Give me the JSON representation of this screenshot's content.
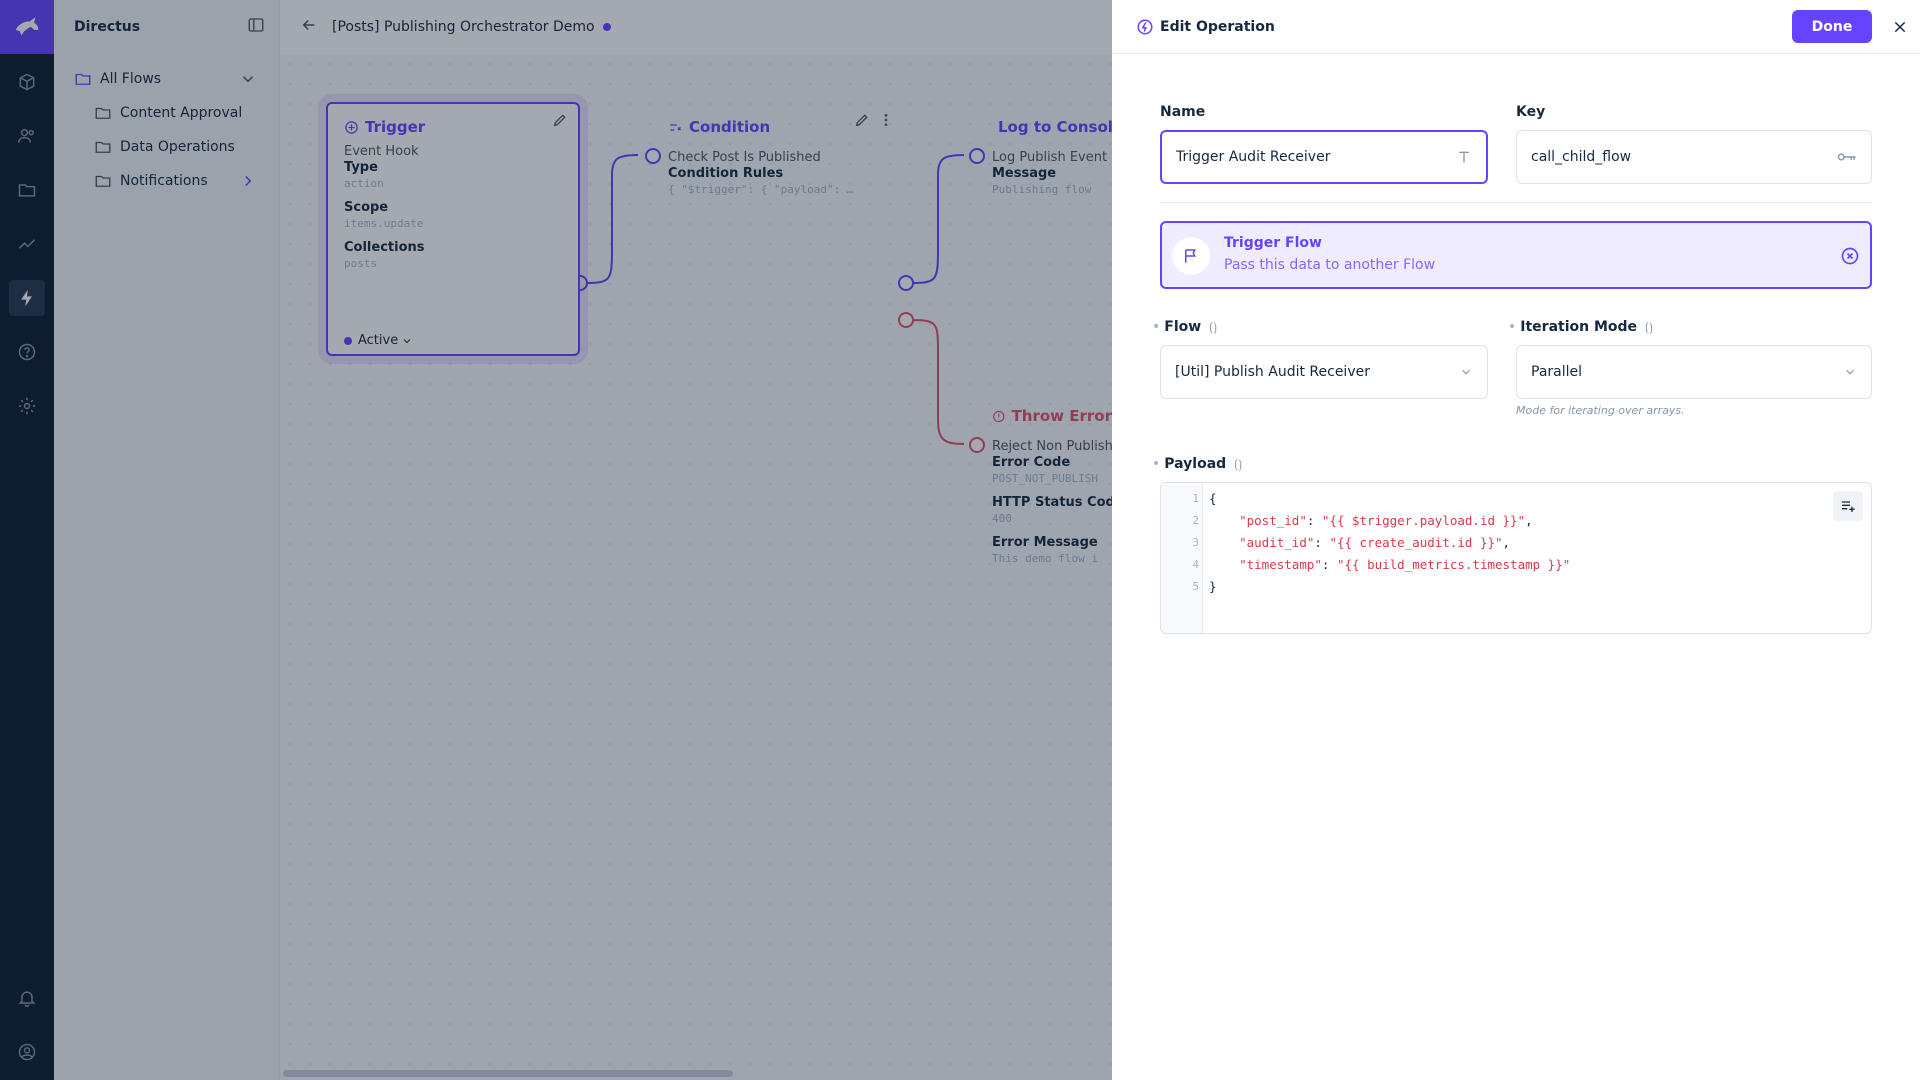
{
  "app": {
    "name": "Directus"
  },
  "header": {
    "title": "[Posts] Publishing Orchestrator Demo"
  },
  "nav": {
    "items": [
      {
        "label": "All Flows"
      },
      {
        "label": "Content Approval"
      },
      {
        "label": "Data Operations"
      },
      {
        "label": "Notifications"
      }
    ]
  },
  "canvas": {
    "trigger": {
      "title": "Trigger",
      "subtitle": "Event Hook",
      "type_label": "Type",
      "type_value": "action",
      "scope_label": "Scope",
      "scope_value": "items.update",
      "collections_label": "Collections",
      "collections_value": "posts",
      "status": "Active"
    },
    "condition": {
      "title": "Condition",
      "subtitle": "Check Post Is Published",
      "rules_label": "Condition Rules",
      "rules_value": "{ \"$trigger\": { \"payload\": …"
    },
    "log": {
      "title": "Log to Console",
      "subtitle": "Log Publish Event",
      "message_label": "Message",
      "message_value": "Publishing flow"
    },
    "throw_error": {
      "title": "Throw Error",
      "subtitle": "Reject Non Publishe",
      "code_label": "Error Code",
      "code_value": "POST_NOT_PUBLISH",
      "status_label": "HTTP Status Code",
      "status_value": "400",
      "message_label": "Error Message",
      "message_value": "This demo flow i"
    }
  },
  "drawer": {
    "title": "Edit Operation",
    "done_label": "Done",
    "name_label": "Name",
    "name_value": "Trigger Audit Receiver",
    "key_label": "Key",
    "key_value": "call_child_flow",
    "operation": {
      "title": "Trigger Flow",
      "description": "Pass this data to another Flow"
    },
    "flow_label": "Flow",
    "flow_value": "[Util] Publish Audit Receiver",
    "iteration_label": "Iteration Mode",
    "iteration_value": "Parallel",
    "iteration_hint": "Mode for iterating over arrays.",
    "payload_label": "Payload",
    "payload_lines": [
      {
        "n": "1",
        "text": "{"
      },
      {
        "n": "2",
        "key": "\"post_id\"",
        "value": "\"{{ $trigger.payload.id }}\"",
        "sep": ","
      },
      {
        "n": "3",
        "key": "\"audit_id\"",
        "value": "\"{{ create_audit.id }}\"",
        "sep": ","
      },
      {
        "n": "4",
        "key": "\"timestamp\"",
        "value": "\"{{ build_metrics.timestamp }}\"",
        "sep": ""
      },
      {
        "n": "5",
        "text": "}"
      }
    ]
  },
  "colors": {
    "accent": "#6644ff",
    "rail_bg": "#0e1c2f",
    "overlay": "rgba(16,28,48,0.38)",
    "danger": "#e35169"
  }
}
